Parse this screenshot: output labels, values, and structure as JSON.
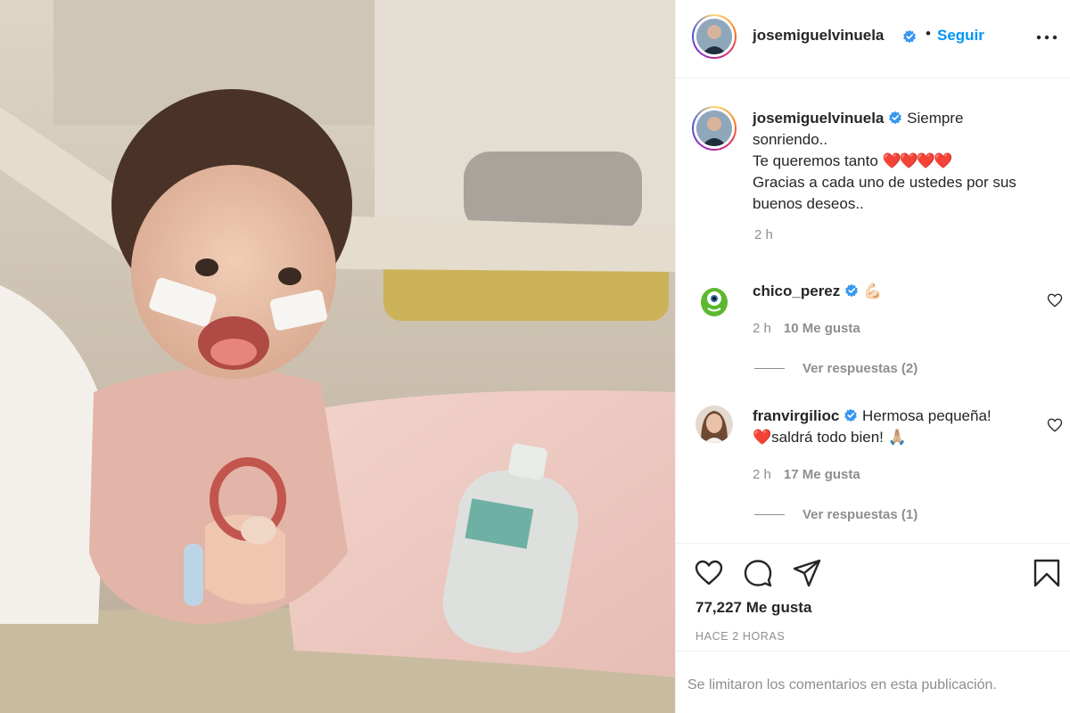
{
  "post": {
    "photo_description": "photo-of-smiling-baby-in-hospital-bed",
    "author": {
      "username": "josemiguelvinuela",
      "verified": true,
      "follow_label": "Seguir",
      "separator": "•"
    },
    "caption": {
      "username": "josemiguelvinuela",
      "line1": "Siempre",
      "line2": "sonriendo..",
      "line3": "Te queremos tanto",
      "line3_emoji": "❤️❤️❤️❤️",
      "line4": "Gracias a cada uno de ustedes por sus",
      "line5": "buenos deseos..",
      "time": "2 h"
    },
    "comments": [
      {
        "username": "chico_perez",
        "verified": true,
        "text": "💪🏻",
        "time": "2 h",
        "likes": "10 Me gusta",
        "replies": "Ver respuestas (2)"
      },
      {
        "username": "franvirgilioc",
        "verified": true,
        "text_line1": "Hermosa pequeña!",
        "text_line2": "❤️saldrá todo bien! 🙏🏼",
        "time": "2 h",
        "likes": "17 Me gusta",
        "replies": "Ver respuestas (1)"
      }
    ],
    "likes_count": "77,227 Me gusta",
    "posted_ago": "HACE 2 HORAS",
    "comments_limited": "Se limitaron los comentarios en esta publicación.",
    "icons": [
      "like-icon",
      "comment-icon",
      "share-icon",
      "save-icon",
      "more-options-icon",
      "verified-badge-icon"
    ],
    "colors": {
      "accent": "#0095f6",
      "verified": "#3897f0",
      "text": "#262626",
      "secondary": "#8e8e8e",
      "border": "#efefef"
    }
  }
}
